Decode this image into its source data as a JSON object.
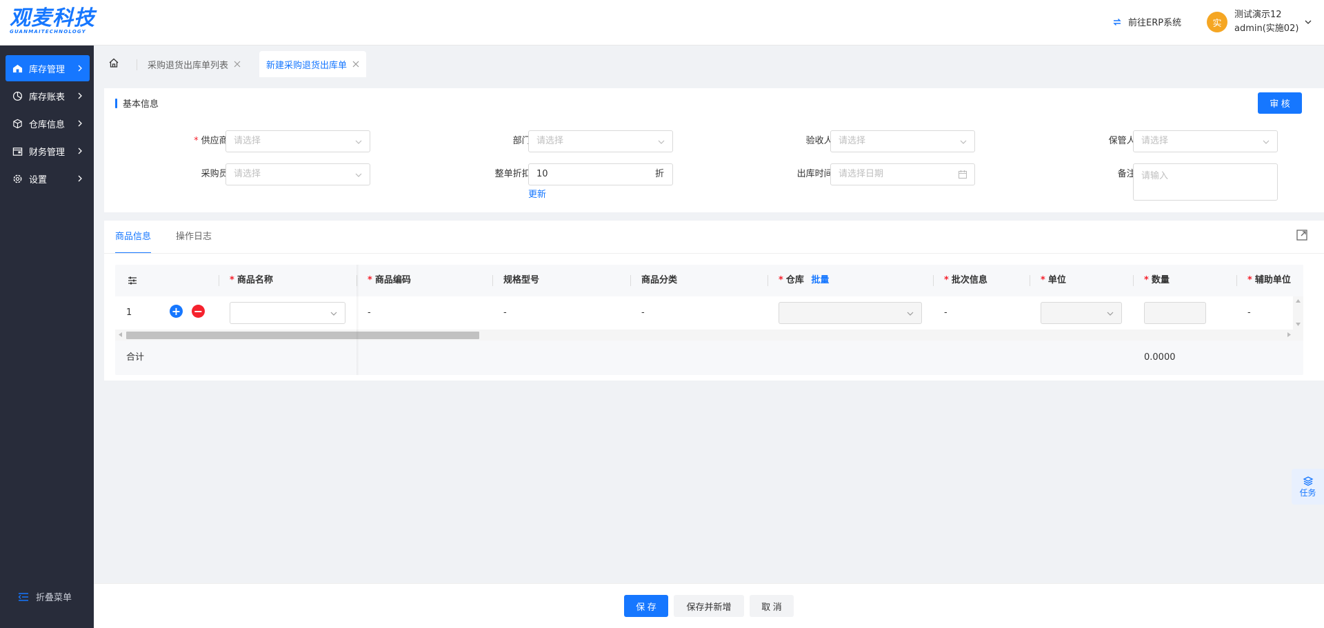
{
  "header": {
    "logo_text": "观麦科技",
    "logo_sub": "GUANMAITECHNOLOGY",
    "erp_link": "前往ERP系统",
    "user": {
      "avatar_char": "实",
      "name": "测试演示12",
      "account": "admin(实施02)"
    }
  },
  "sidebar": {
    "items": [
      {
        "label": "库存管理",
        "icon": "home-store-icon",
        "active": true
      },
      {
        "label": "库存账表",
        "icon": "pie-chart-icon",
        "active": false
      },
      {
        "label": "仓库信息",
        "icon": "cube-icon",
        "active": false
      },
      {
        "label": "财务管理",
        "icon": "wallet-icon",
        "active": false
      },
      {
        "label": "设置",
        "icon": "gear-icon",
        "active": false
      }
    ],
    "collapse_label": "折叠菜单"
  },
  "tabs": [
    {
      "label": "采购退货出库单列表",
      "active": false
    },
    {
      "label": "新建采购退货出库单",
      "active": true
    }
  ],
  "basic": {
    "title": "基本信息",
    "audit_button": "审 核",
    "fields": {
      "supplier": {
        "label": "供应商:",
        "required": true,
        "placeholder": "请选择"
      },
      "department": {
        "label": "部门:",
        "placeholder": "请选择"
      },
      "receiver": {
        "label": "验收人:",
        "placeholder": "请选择"
      },
      "keeper": {
        "label": "保管人:",
        "placeholder": "请选择"
      },
      "buyer": {
        "label": "采购员:",
        "placeholder": "请选择"
      },
      "discount": {
        "label": "整单折扣:",
        "value": "10",
        "suffix": "折"
      },
      "out_time": {
        "label": "出库时间:",
        "placeholder": "请选择日期"
      },
      "remark": {
        "label": "备注:",
        "placeholder": "请输入"
      }
    },
    "update_link": "更新"
  },
  "goods": {
    "tabs": [
      "商品信息",
      "操作日志"
    ],
    "columns": {
      "name": "商品名称",
      "code": "商品编码",
      "spec": "规格型号",
      "category": "商品分类",
      "warehouse": "仓库",
      "batch_link": "批量",
      "batch_info": "批次信息",
      "unit": "单位",
      "qty": "数量",
      "aux_unit": "辅助单位"
    },
    "row": {
      "index": "1",
      "code": "-",
      "spec": "-",
      "category": "-",
      "batch_info": "-",
      "aux_unit": "-"
    },
    "total_label": "合计",
    "total_qty": "0.0000"
  },
  "footer": {
    "save": "保 存",
    "save_new": "保存并新增",
    "cancel": "取 消"
  },
  "task_label": "任务",
  "colors": {
    "primary": "#1677ff",
    "sidebar_bg": "#282c3a",
    "danger": "#f5222d"
  }
}
